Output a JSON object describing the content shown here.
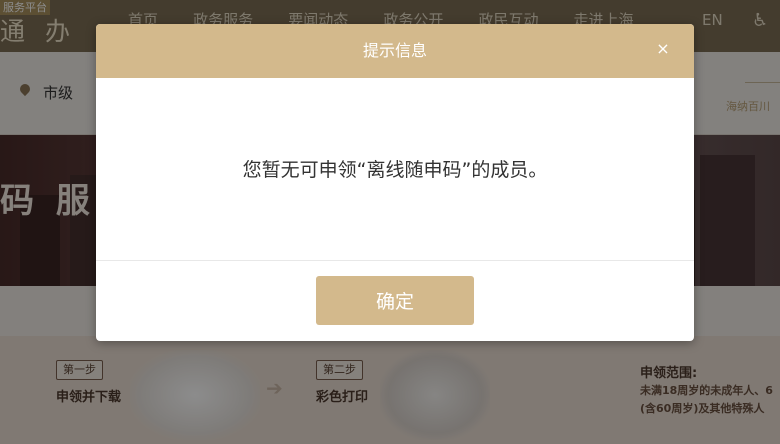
{
  "header": {
    "brand_small": "服务平台",
    "brand_big": "通 办",
    "nav": [
      "首页",
      "政务服务",
      "要闻动态",
      "政务公开",
      "政民互动",
      "走进上海"
    ],
    "lang": "EN"
  },
  "location": {
    "current": "市级",
    "right_text": "海纳百川"
  },
  "banner": {
    "title": "码 服 务"
  },
  "steps": {
    "step1_tag": "第一步",
    "step1_label": "申领并下载",
    "step2_tag": "第二步",
    "step2_label": "彩色打印",
    "scope_title": "申领范围:",
    "scope_line1": "未满18周岁的未成年人、6",
    "scope_line2": "(含60周岁)及其他特殊人"
  },
  "modal": {
    "title": "提示信息",
    "close_glyph": "×",
    "message": "您暂无可申领“离线随申码”的成员。",
    "confirm_label": "确定"
  },
  "colors": {
    "modal_accent": "#d3b98c",
    "top_bar": "#7d6e55"
  }
}
